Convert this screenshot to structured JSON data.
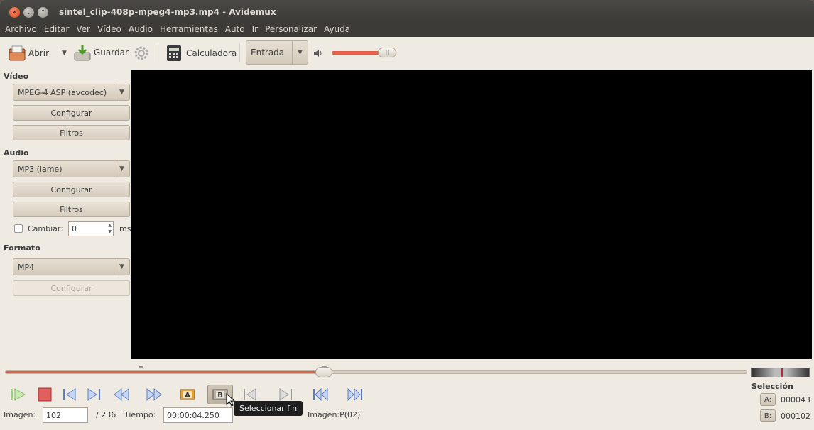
{
  "window": {
    "title": "sintel_clip-408p-mpeg4-mp3.mp4 - Avidemux"
  },
  "menu": [
    "Archivo",
    "Editar",
    "Ver",
    "Vídeo",
    "Audio",
    "Herramientas",
    "Auto",
    "Ir",
    "Personalizar",
    "Ayuda"
  ],
  "toolbar": {
    "open_label": "Abrir",
    "save_label": "Guardar",
    "calculator_label": "Calculadora",
    "input_mode": "Entrada",
    "volume_level": 0.85
  },
  "left_panel": {
    "video_heading": "Vídeo",
    "video_codec": "MPEG-4 ASP (avcodec)",
    "video_configure": "Configurar",
    "video_filters": "Filtros",
    "audio_heading": "Audio",
    "audio_codec": "MP3 (lame)",
    "audio_configure": "Configurar",
    "audio_filters": "Filtros",
    "shift_label": "Cambiar:",
    "shift_value": "0",
    "shift_unit": "ms",
    "format_heading": "Formato",
    "format_value": "MP4",
    "format_configure": "Configurar"
  },
  "timeline": {
    "position_fraction": 0.43
  },
  "tooltip": "Seleccionar fin",
  "status": {
    "frame_label": "Imagen:",
    "frame_value": "102",
    "frame_total": "/ 236",
    "time_label": "Tiempo:",
    "time_value": "00:00:04.250",
    "frame_type": "Imagen:P(02)"
  },
  "selection": {
    "title": "Selección",
    "a_label": "A:",
    "a_value": "000043",
    "b_label": "B:",
    "b_value": "000102"
  },
  "colors": {
    "accent": "#e2604a",
    "titlebar": "#3c3b37",
    "window_bg": "#f0ebe2"
  }
}
